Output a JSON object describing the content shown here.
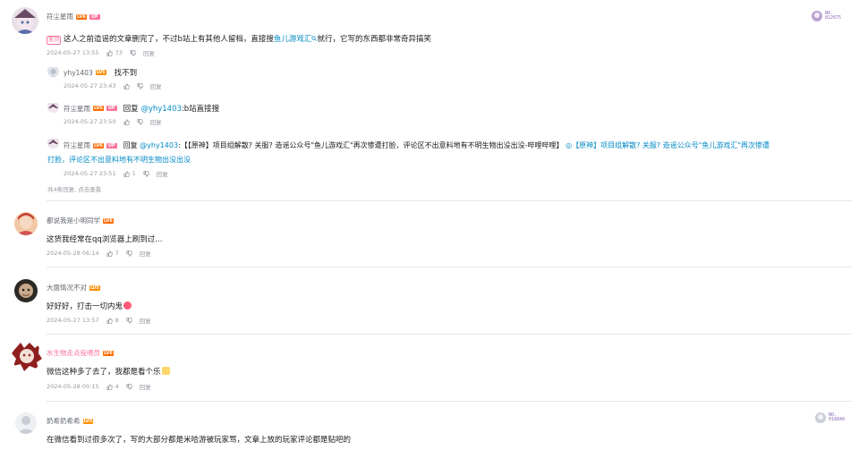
{
  "comments": [
    {
      "user": "符尘星雨",
      "level": "LV6",
      "up_tag": "UP",
      "pin_label": "置顶",
      "text_a": "这人之前造谣的文章删完了，不过b站上有其他人留档，直接搜",
      "text_link": "鱼儿游戏汇",
      "text_b": "就行，它写的东西都非常奇异搞笑",
      "date": "2024-05-27 13:55",
      "likes": "73",
      "reply_label": "回复",
      "badge": {
        "line1": "NO.",
        "line2": "022675"
      },
      "replies": [
        {
          "user": "yhy1403",
          "level": "LV5",
          "text": "找不到",
          "date": "2024-05-27 23:43",
          "likes": "",
          "reply_label": "回复"
        },
        {
          "user": "符尘星雨",
          "level": "LV6",
          "up_tag": "UP",
          "reply_word": "回复",
          "mention": "@yhy1403",
          "text": ":b站直接搜",
          "date": "2024-05-27 23:50",
          "likes": "",
          "reply_label": "回复"
        },
        {
          "user": "符尘星雨",
          "level": "LV6",
          "up_tag": "UP",
          "reply_word": "回复",
          "mention": "@yhy1403",
          "text_a": ":【【原神】项目组解散? 关服? 造谣公众号\"鱼儿游戏汇\"再次惨遭打脸，评论区不出意料地有不明生物出没出没-哔哩哔哩】",
          "link_line1": "◎【原神】项目组解散? 关服? 造谣公众号\"鱼儿游戏汇\"再次惨遭",
          "link_line2": "打脸，评论区不出意料地有不明生物出没出没",
          "date": "2024-05-27 23:51",
          "likes": "1",
          "reply_label": "回复"
        }
      ],
      "more_replies": "共4条回复, 点击查看"
    },
    {
      "user": "都说我是小明同学",
      "level": "LV6",
      "text": "这货我经常在qq浏览器上刷到过...",
      "date": "2024-05-28 06:14",
      "likes": "7",
      "reply_label": "回复"
    },
    {
      "user": "大面情况不对",
      "level": "LV5",
      "text": "好好好，打击一切内鬼",
      "date": "2024-05-27 13:57",
      "likes": "8",
      "reply_label": "回复"
    },
    {
      "user": "水生物走点投喂员",
      "level": "LV6",
      "text": "微信这种多了去了，我都是看个乐",
      "date": "2024-05-28 00:15",
      "likes": "4",
      "reply_label": "回复"
    },
    {
      "user": "奶希奶希希",
      "level": "LV5",
      "text": "在微信看到过很多次了，写的大部分都是米哈游被玩家骂，文章上放的玩家评论都是贴吧的",
      "badge": {
        "line1": "NO.",
        "line2": "018840"
      }
    }
  ],
  "colors": {
    "link": "#008ac5",
    "up": "#fb7299",
    "meta": "#9499a0",
    "divider": "#e3e5e7"
  }
}
